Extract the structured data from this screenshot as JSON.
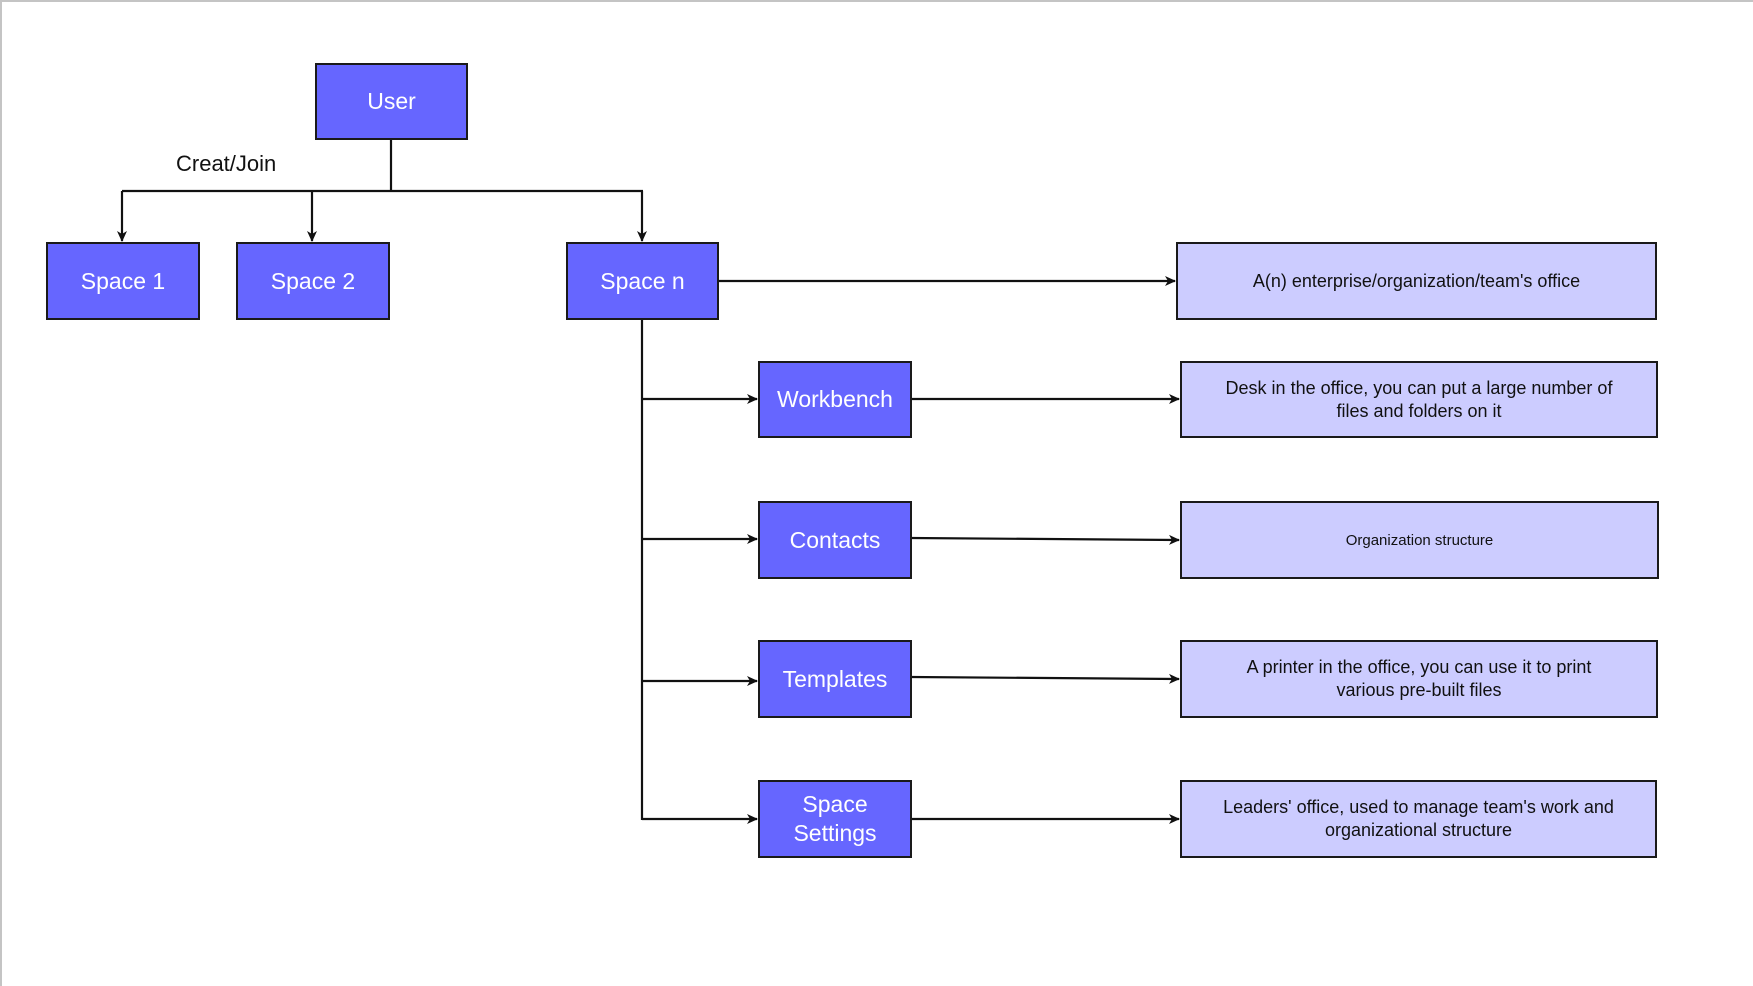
{
  "colors": {
    "primary_fill": "#6666ff",
    "desc_fill": "#ccccff",
    "stroke": "#1a1a1a"
  },
  "diagram": {
    "edge_label": "Creat/Join",
    "root": {
      "label": "User"
    },
    "spaces": [
      {
        "label": "Space 1"
      },
      {
        "label": "Space 2"
      },
      {
        "label": "Space n"
      }
    ],
    "space_description": "A(n) enterprise/organization/team's office",
    "features": [
      {
        "label": "Workbench",
        "description": "Desk in the office, you can put a large number of files and folders on it"
      },
      {
        "label": "Contacts",
        "description": "Organization structure"
      },
      {
        "label": "Templates",
        "description": "A printer in the office, you can use it to print various pre-built files"
      },
      {
        "label": "Space Settings",
        "description": "Leaders' office, used to manage team's work and organizational structure"
      }
    ]
  }
}
